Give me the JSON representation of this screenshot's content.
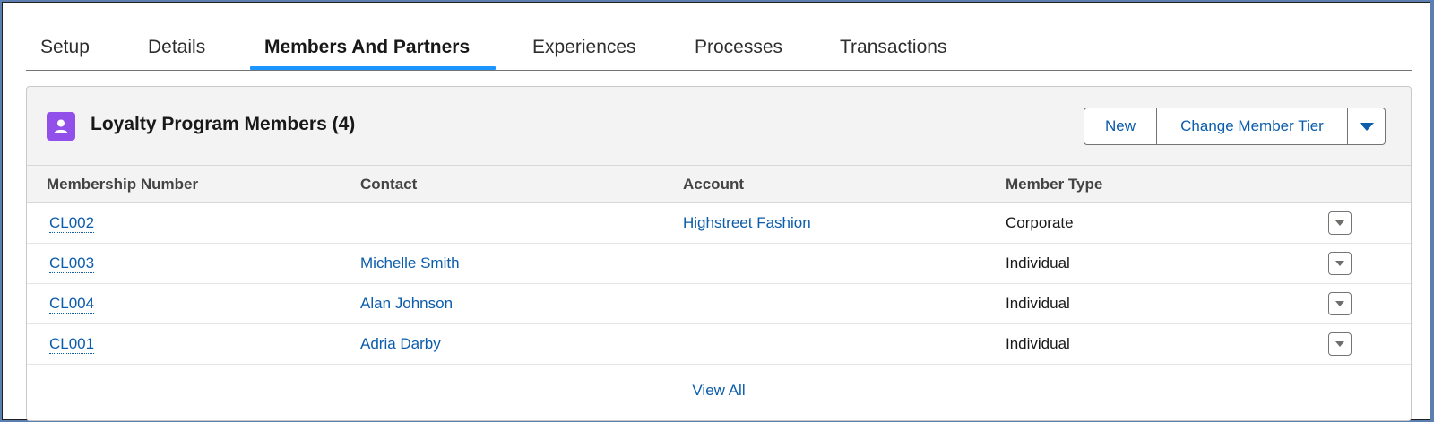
{
  "tabs": [
    {
      "label": "Setup"
    },
    {
      "label": "Details"
    },
    {
      "label": "Members And Partners"
    },
    {
      "label": "Experiences"
    },
    {
      "label": "Processes"
    },
    {
      "label": "Transactions"
    }
  ],
  "active_tab": "Members And Partners",
  "card": {
    "icon": "user-icon",
    "icon_color": "#9050e9",
    "title": "Loyalty Program Members (4)",
    "buttons": {
      "new_label": "New",
      "change_tier_label": "Change Member Tier"
    }
  },
  "table": {
    "columns": [
      "Membership Number",
      "Contact",
      "Account",
      "Member Type"
    ],
    "rows": [
      {
        "membership_number": "CL002",
        "contact": "",
        "account": "Highstreet Fashion",
        "member_type": "Corporate"
      },
      {
        "membership_number": "CL003",
        "contact": "Michelle Smith",
        "account": "",
        "member_type": "Individual"
      },
      {
        "membership_number": "CL004",
        "contact": "Alan Johnson",
        "account": "",
        "member_type": "Individual"
      },
      {
        "membership_number": "CL001",
        "contact": "Adria Darby",
        "account": "",
        "member_type": "Individual"
      }
    ]
  },
  "footer": {
    "view_all_label": "View All"
  },
  "colors": {
    "link": "#0b5cab",
    "active_tab_underline": "#1b96ff"
  }
}
